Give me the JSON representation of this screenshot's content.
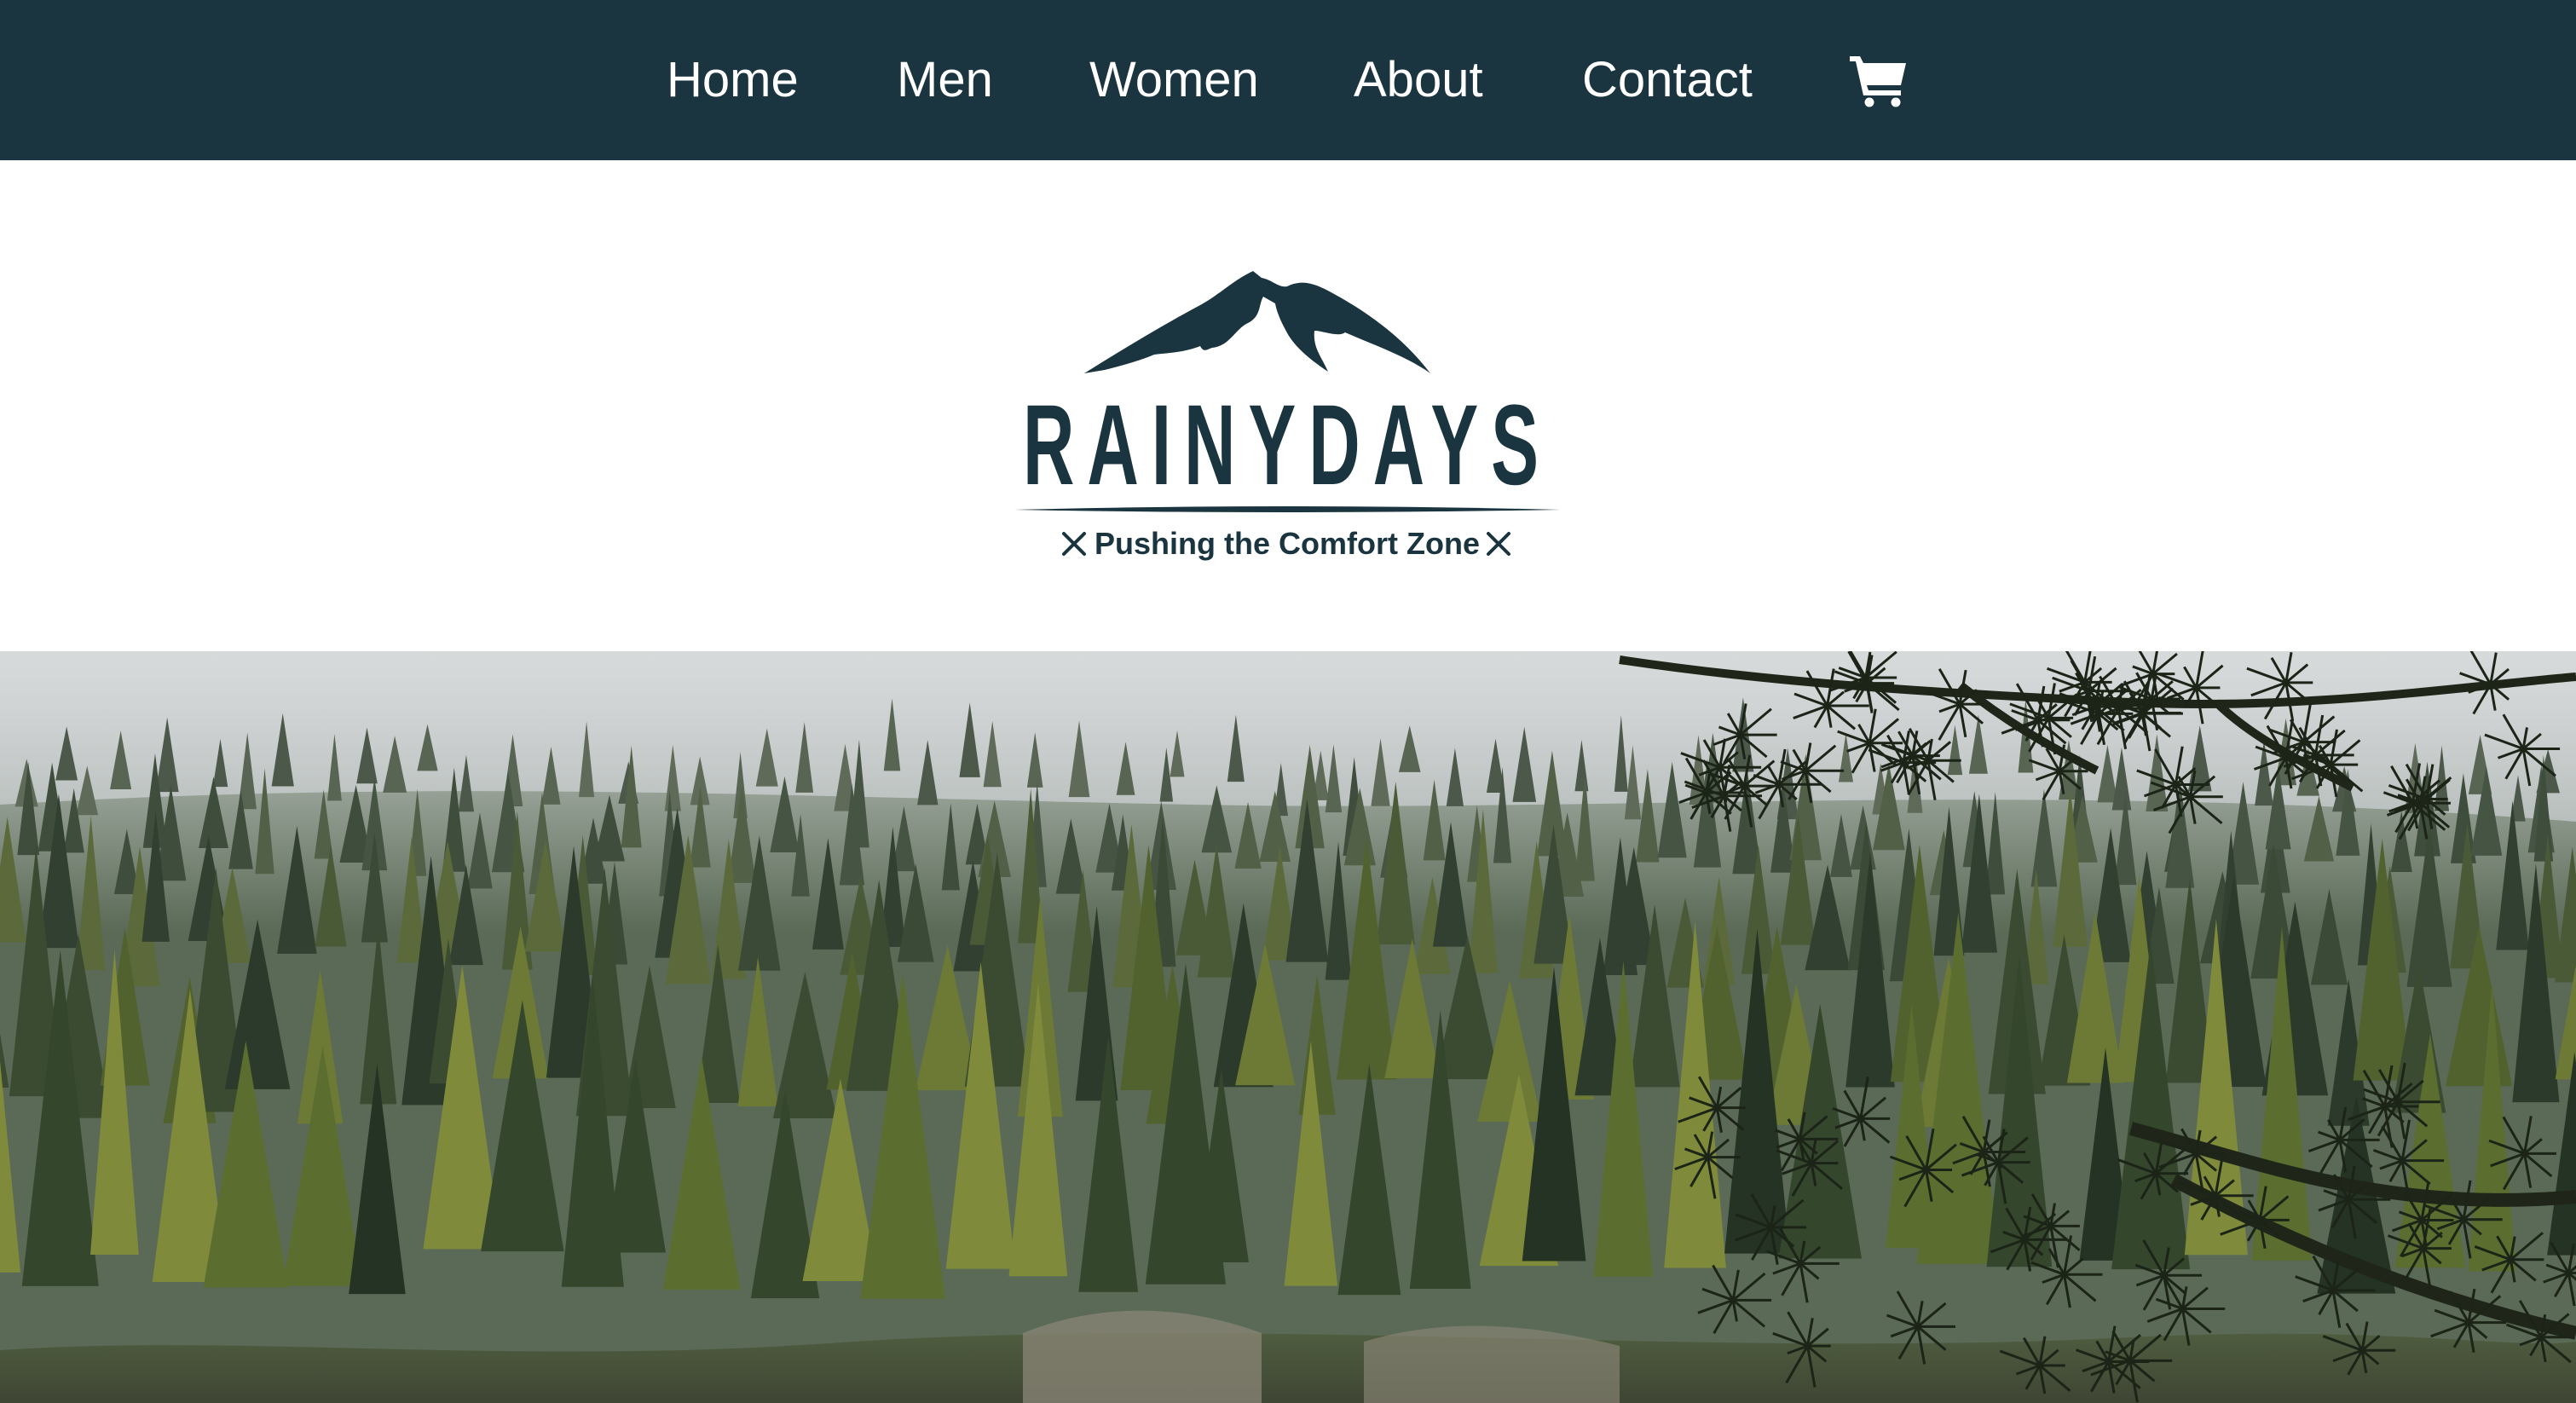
{
  "nav": {
    "items": [
      {
        "label": "Home"
      },
      {
        "label": "Men"
      },
      {
        "label": "Women"
      },
      {
        "label": "About"
      },
      {
        "label": "Contact"
      }
    ],
    "cart_icon": "shopping-cart-icon",
    "background_color": "#1a3440",
    "text_color": "#ffffff"
  },
  "logo": {
    "brand": "RAINYDAYS",
    "tagline": "Pushing the Comfort Zone",
    "color": "#1a3440"
  },
  "hero": {
    "image": "misty conifer forest"
  }
}
